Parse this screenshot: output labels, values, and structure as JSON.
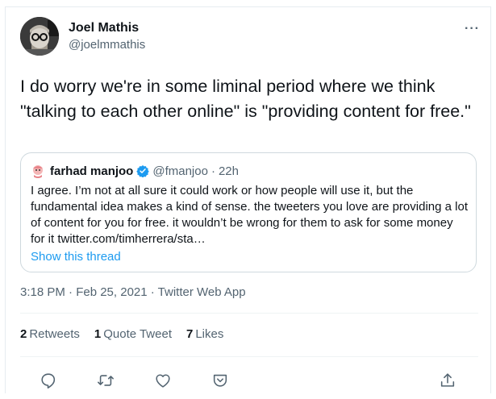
{
  "author": {
    "name": "Joel Mathis",
    "handle": "@joelmmathis"
  },
  "more_label": "···",
  "tweet_text": "I do worry we're in some liminal period where we think \"talking to each other online\" is \"providing content for free.\"",
  "quoted": {
    "name": "farhad manjoo",
    "handle": "@fmanjoo",
    "separator": "·",
    "time": "22h",
    "text": "I agree. I’m not at all sure it could work or how people will use it, but the fundamental idea makes a kind of sense. the tweeters you love are providing a lot of content for you for free. it wouldn’t be wrong for them to ask for some money for it twitter.com/timherrera/sta…",
    "show_thread": "Show this thread"
  },
  "meta": "3:18 PM · Feb 25, 2021 · Twitter Web App",
  "stats": {
    "retweets_count": "2",
    "retweets_label": "Retweets",
    "quotes_count": "1",
    "quotes_label": "Quote Tweet",
    "likes_count": "7",
    "likes_label": "Likes"
  },
  "colors": {
    "accent": "#1d9bf0",
    "secondary_text": "#536471",
    "border": "#cfd9de"
  },
  "icons": [
    "reply-icon",
    "retweet-icon",
    "like-icon",
    "tip-icon",
    "share-icon",
    "verified-icon"
  ]
}
